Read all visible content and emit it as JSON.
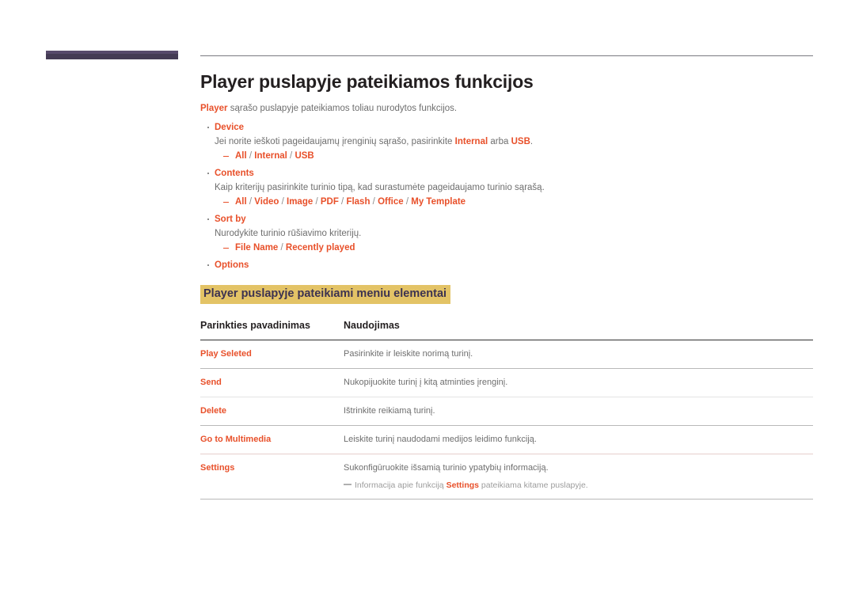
{
  "header": {
    "bar_color": "#443b54",
    "rule_color": "#7a7a80"
  },
  "colors": {
    "accent": "#e8502a",
    "highlight_bg": "#e3c366",
    "highlight_text": "#3c3250",
    "body_text": "#6e6e6e",
    "heading_text": "#231f20"
  },
  "page": {
    "title": "Player puslapyje pateikiamos funkcijos",
    "intro_accent": "Player",
    "intro_rest": " sąrašo puslapyje pateikiamos toliau nurodytos funkcijos."
  },
  "bullets": [
    {
      "title": "Device",
      "desc_parts": [
        {
          "text": "Jei norite ieškoti pageidaujamų įrenginių sąrašo, pasirinkite ",
          "style": "plain"
        },
        {
          "text": "Internal",
          "style": "accent"
        },
        {
          "text": " arba ",
          "style": "plain"
        },
        {
          "text": "USB",
          "style": "accent"
        },
        {
          "text": ".",
          "style": "plain"
        }
      ],
      "options": [
        "All",
        "Internal",
        "USB"
      ]
    },
    {
      "title": "Contents",
      "desc_parts": [
        {
          "text": "Kaip kriterijų pasirinkite turinio tipą, kad surastumėte pageidaujamo turinio sąrašą.",
          "style": "plain"
        }
      ],
      "options": [
        "All",
        "Video",
        "Image",
        "PDF",
        "Flash",
        "Office",
        "My Template"
      ]
    },
    {
      "title": "Sort by",
      "desc_parts": [
        {
          "text": "Nurodykite turinio rūšiavimo kriterijų.",
          "style": "plain"
        }
      ],
      "options": [
        "File Name",
        "Recently played"
      ]
    },
    {
      "title": "Options",
      "desc_parts": [],
      "options": []
    }
  ],
  "subheading": "Player puslapyje pateikiami meniu elementai",
  "table": {
    "headers": [
      "Parinkties pavadinimas",
      "Naudojimas"
    ],
    "rows": [
      {
        "name": "Play Seleted",
        "desc": "Pasirinkite ir leiskite norimą turinį.",
        "divider": "normal"
      },
      {
        "name": "Send",
        "desc": "Nukopijuokite turinį į kitą atminties įrenginį.",
        "divider": "alt"
      },
      {
        "name": "Delete",
        "desc": "Ištrinkite reikiamą turinį.",
        "divider": "normal"
      },
      {
        "name": "Go to Multimedia",
        "desc": "Leiskite turinį naudodami medijos leidimo funkciją.",
        "divider": "pink"
      },
      {
        "name": "Settings",
        "desc": "Sukonfigūruokite išsamią turinio ypatybių informaciją.",
        "divider": "normal"
      }
    ],
    "note": {
      "before": "Informacija apie funkciją ",
      "bold": "Settings",
      "after": " pateikiama kitame puslapyje."
    }
  }
}
